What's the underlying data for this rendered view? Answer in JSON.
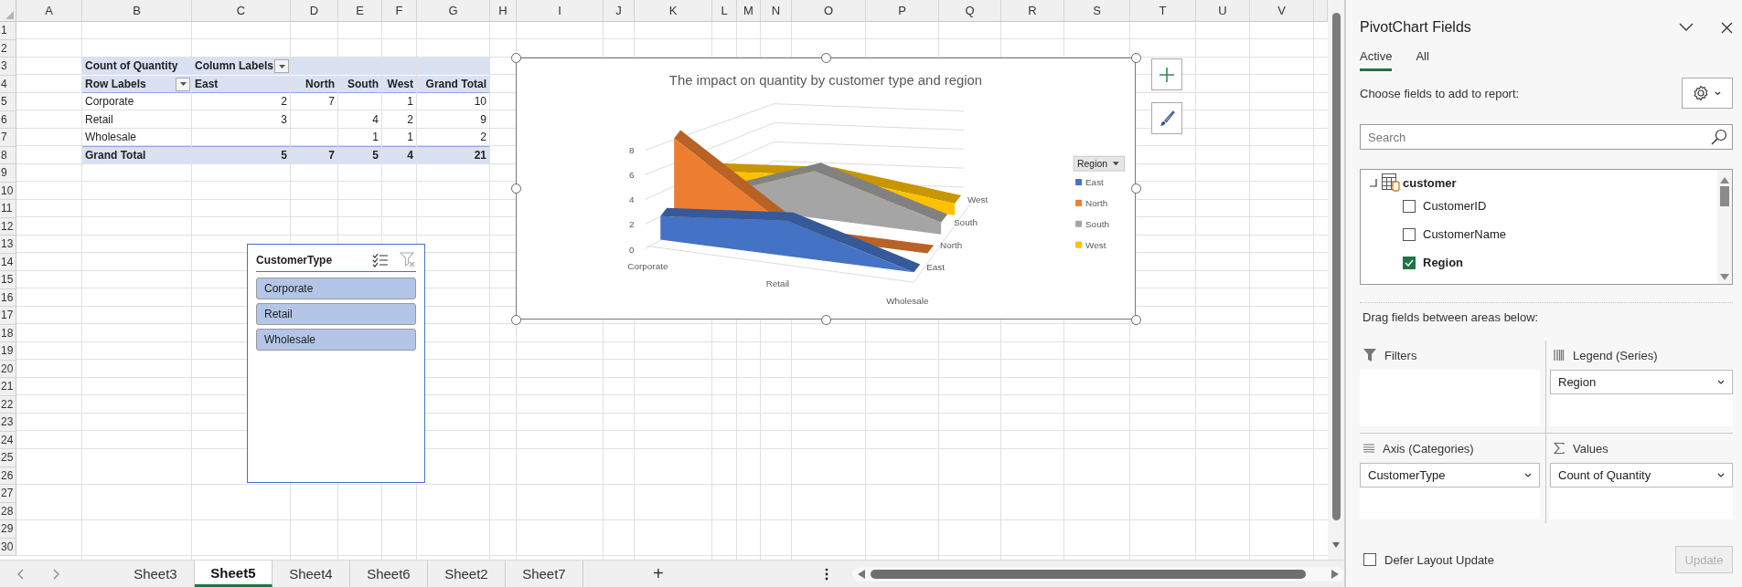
{
  "sheet": {
    "columns": [
      "A",
      "B",
      "C",
      "D",
      "E",
      "F",
      "G",
      "H",
      "I",
      "J",
      "K",
      "L",
      "M",
      "N",
      "O",
      "P",
      "Q",
      "R",
      "S",
      "T",
      "U",
      "V"
    ],
    "rows": [
      "1",
      "2",
      "3",
      "4",
      "5",
      "6",
      "7",
      "8",
      "9",
      "10",
      "11",
      "12",
      "13",
      "14",
      "15",
      "16",
      "17",
      "18",
      "19",
      "20",
      "21",
      "22",
      "23",
      "24",
      "25",
      "26",
      "27",
      "28",
      "29",
      "30"
    ]
  },
  "pivot_table": {
    "value_field": "Count of Quantity",
    "column_labels": "Column Labels",
    "row_labels": "Row Labels",
    "columns": [
      "East",
      "North",
      "South",
      "West",
      "Grand Total"
    ],
    "rows": [
      {
        "label": "Corporate",
        "east": "2",
        "north": "7",
        "west": "1",
        "grand_total": "10"
      },
      {
        "label": "Retail",
        "east": "3",
        "south": "4",
        "west": "2",
        "grand_total": "9"
      },
      {
        "label": "Wholesale",
        "south": "1",
        "west": "1",
        "grand_total": "2"
      }
    ],
    "grand_total": {
      "label": "Grand Total",
      "east": "5",
      "north": "7",
      "south": "5",
      "west": "4",
      "grand_total": "21"
    }
  },
  "slicer": {
    "title": "CustomerType",
    "items": [
      {
        "label": "Corporate",
        "selected": true
      },
      {
        "label": "Retail",
        "selected": true
      },
      {
        "label": "Wholesale",
        "selected": true
      }
    ]
  },
  "chart": {
    "title": "The impact on quantity by customer type and region",
    "y_axis_labels": [
      "8",
      "6",
      "4",
      "2",
      "0"
    ],
    "category_labels": [
      "Corporate",
      "Retail",
      "Wholesale"
    ],
    "series_axis_labels": [
      "East",
      "North",
      "South",
      "West"
    ],
    "legend": {
      "title": "Region",
      "entries": [
        {
          "label": "East",
          "color": "#4472c4"
        },
        {
          "label": "North",
          "color": "#ed7d31"
        },
        {
          "label": "South",
          "color": "#a5a5a5"
        },
        {
          "label": "West",
          "color": "#ffc000"
        }
      ]
    }
  },
  "sheet_tabs": [
    {
      "label": "Sheet3",
      "selected": false
    },
    {
      "label": "Sheet5",
      "selected": true
    },
    {
      "label": "Sheet4",
      "selected": false
    },
    {
      "label": "Sheet6",
      "selected": false
    },
    {
      "label": "Sheet2",
      "selected": false
    },
    {
      "label": "Sheet7",
      "selected": false
    }
  ],
  "add_sheet": "+",
  "field_panel": {
    "title": "PivotChart Fields",
    "tabs": [
      {
        "label": "Active",
        "selected": true
      },
      {
        "label": "All",
        "selected": false
      }
    ],
    "instruction": "Choose fields to add to report:",
    "search": {
      "placeholder": "Search"
    },
    "tables": [
      {
        "label": "customer",
        "expanded": true,
        "children": [
          {
            "label": "CustomerID",
            "checked": false
          },
          {
            "label": "CustomerName",
            "checked": false
          },
          {
            "label": "Region",
            "checked": true
          }
        ]
      }
    ],
    "areas_instruction": "Drag fields between areas below:",
    "areas": [
      {
        "kind": "filters",
        "label": "Filters"
      },
      {
        "kind": "legend",
        "label": "Legend (Series)",
        "field": "Region"
      },
      {
        "kind": "axis",
        "label": "Axis (Categories)",
        "field": "CustomerType"
      },
      {
        "kind": "values",
        "label": "Values",
        "field": "Count of Quantity"
      }
    ],
    "defer": {
      "label": "Defer Layout Update",
      "checked": false
    },
    "update_button": {
      "label": "Update",
      "disabled": true
    }
  }
}
